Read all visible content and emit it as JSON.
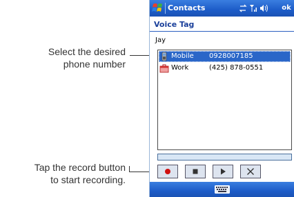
{
  "callouts": {
    "select_line1": "Select the desired",
    "select_line2": "phone number",
    "record_line1": "Tap the record button",
    "record_line2": "to start recording."
  },
  "titlebar": {
    "app_title": "Contacts",
    "ok_label": "ok",
    "start_icon": "windows-flag-icon",
    "status_icons": [
      "connectivity-icon",
      "signal-icon",
      "volume-icon"
    ]
  },
  "page": {
    "header": "Voice Tag",
    "contact_name": "Jay"
  },
  "phone_list": [
    {
      "type": "Mobile",
      "number": "0928007185",
      "icon": "mobile-phone-icon",
      "selected": true
    },
    {
      "type": "Work",
      "number": "(425) 878-0551",
      "icon": "work-briefcase-icon",
      "selected": false
    }
  ],
  "controls": [
    "record-icon",
    "stop-icon",
    "play-icon",
    "delete-icon"
  ],
  "menubar": {
    "input_icon": "keyboard-icon"
  },
  "colors": {
    "title_bar": "#1d5cc8",
    "selection": "#2a66c8",
    "header_text": "#1a3f9a",
    "record_dot": "#d01010"
  }
}
